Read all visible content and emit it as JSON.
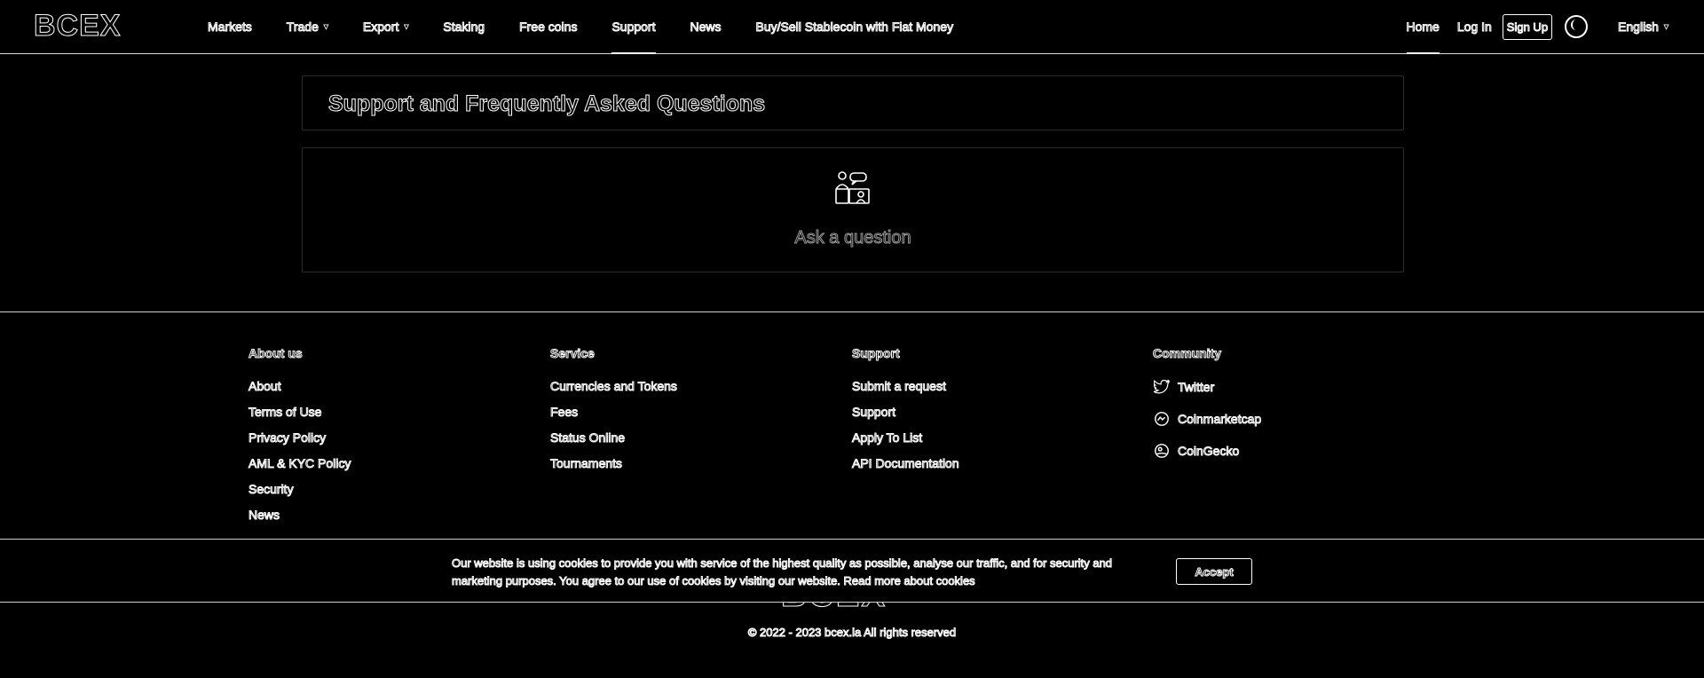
{
  "header": {
    "logo": "BCEX",
    "nav": [
      {
        "label": "Markets"
      },
      {
        "label": "Trade",
        "dropdown": true
      },
      {
        "label": "Export",
        "dropdown": true
      },
      {
        "label": "Staking"
      },
      {
        "label": "Free coins"
      },
      {
        "label": "Support",
        "active": true
      },
      {
        "label": "News"
      },
      {
        "label": "Buy/Sell Stablecoin with Fiat Money"
      }
    ],
    "home": "Home",
    "login": "Log In",
    "signup": "Sign Up",
    "language": "English"
  },
  "main": {
    "title": "Support and Frequently Asked Questions",
    "ask_label": "Ask a question"
  },
  "footer": {
    "about": {
      "title": "About us",
      "links": [
        "About",
        "Terms of Use",
        "Privacy Policy",
        "AML & KYC Policy",
        "Security",
        "News"
      ]
    },
    "service": {
      "title": "Service",
      "links": [
        "Currencies and Tokens",
        "Fees",
        "Status Online",
        "Tournaments"
      ]
    },
    "support": {
      "title": "Support",
      "links": [
        "Submit a request",
        "Support",
        "Apply To List",
        "API Documentation"
      ]
    },
    "community": {
      "title": "Community",
      "links": [
        {
          "label": "Twitter",
          "icon": "twitter-icon"
        },
        {
          "label": "Coinmarketcap",
          "icon": "coinmarketcap-icon"
        },
        {
          "label": "CoinGecko",
          "icon": "coingecko-icon"
        }
      ]
    },
    "logo": "BCEX",
    "copyright": "© 2022 - 2023 bcex.la All rights reserved"
  },
  "cookie": {
    "text": "Our website is using cookies to provide you with service of the highest quality as possible, analyse our traffic, and for security and marketing purposes. You agree to our use of cookies by visiting our website. Read more about cookies",
    "accept": "Accept"
  }
}
